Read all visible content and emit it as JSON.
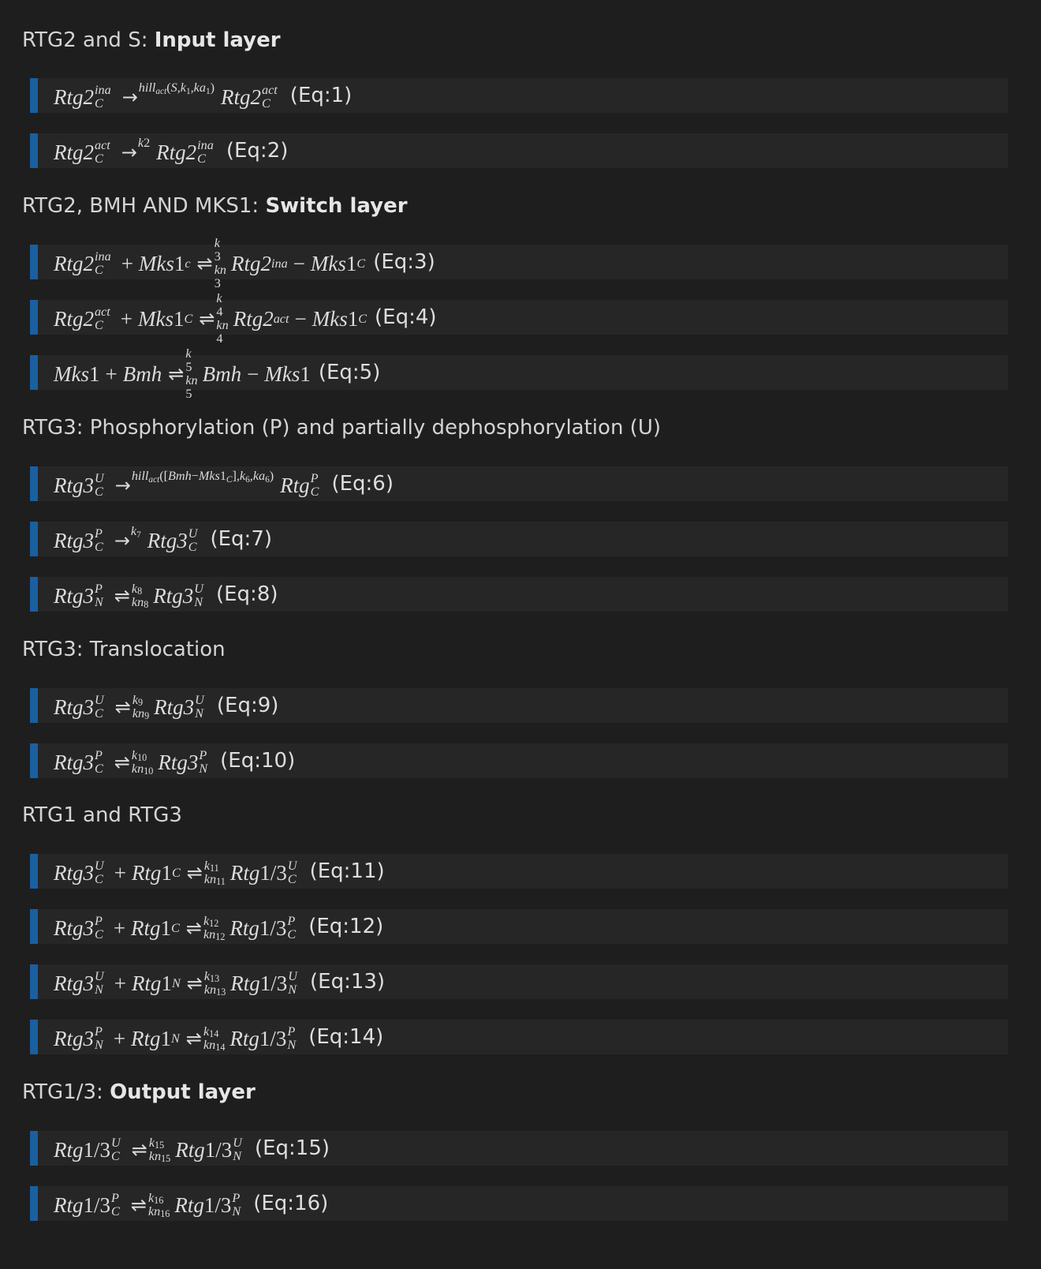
{
  "sections": [
    {
      "plain": "RTG2 and S: ",
      "bold": "Input layer"
    },
    {
      "plain": "RTG2, BMH AND MKS1: ",
      "bold": "Switch layer"
    },
    {
      "plain": "RTG3: Phosphorylation (P) and partially dephosphorylation (U)",
      "bold": ""
    },
    {
      "plain": "RTG3: Translocation",
      "bold": ""
    },
    {
      "plain": "RTG1 and RTG3",
      "bold": ""
    },
    {
      "plain": "RTG1/3: ",
      "bold": "Output layer"
    }
  ],
  "equations": [
    {
      "label": "(Eq:1)"
    },
    {
      "label": "(Eq:2)"
    },
    {
      "label": "(Eq:3)"
    },
    {
      "label": "(Eq:4)"
    },
    {
      "label": "(Eq:5)"
    },
    {
      "label": "(Eq:6)"
    },
    {
      "label": "(Eq:7)"
    },
    {
      "label": "(Eq:8)"
    },
    {
      "label": "(Eq:9)"
    },
    {
      "label": "(Eq:10)"
    },
    {
      "label": "(Eq:11)"
    },
    {
      "label": "(Eq:12)"
    },
    {
      "label": "(Eq:13)"
    },
    {
      "label": "(Eq:14)"
    },
    {
      "label": "(Eq:15)"
    },
    {
      "label": "(Eq:16)"
    }
  ],
  "accent_color": "#1a5fa0",
  "background_color": "#1e1e1e",
  "equation_background_color": "#262626"
}
